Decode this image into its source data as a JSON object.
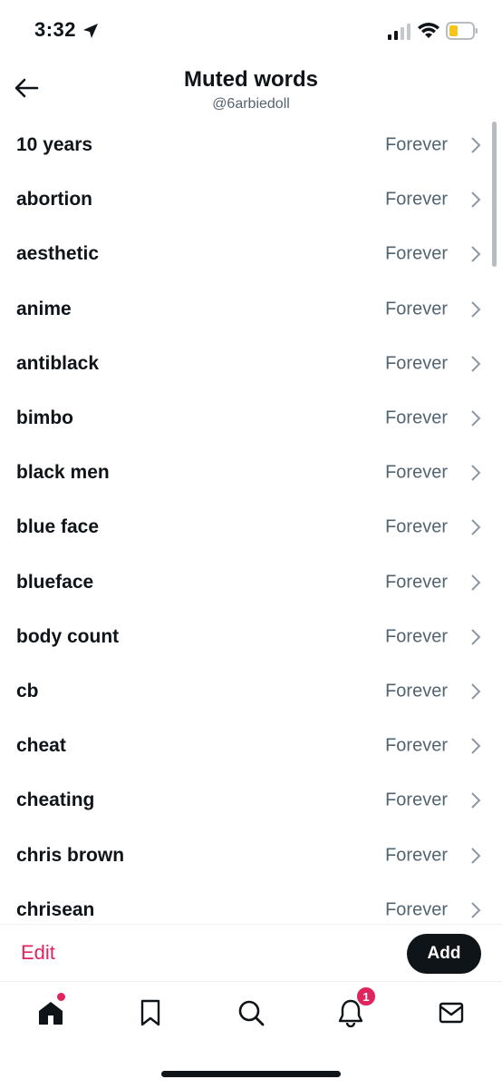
{
  "status_bar": {
    "time": "3:32"
  },
  "header": {
    "title": "Muted words",
    "subtitle": "@6arbiedoll"
  },
  "muted_words": [
    {
      "word": "10 years",
      "duration": "Forever"
    },
    {
      "word": "abortion",
      "duration": "Forever"
    },
    {
      "word": "aesthetic",
      "duration": "Forever"
    },
    {
      "word": "anime",
      "duration": "Forever"
    },
    {
      "word": "antiblack",
      "duration": "Forever"
    },
    {
      "word": "bimbo",
      "duration": "Forever"
    },
    {
      "word": "black men",
      "duration": "Forever"
    },
    {
      "word": "blue face",
      "duration": "Forever"
    },
    {
      "word": "blueface",
      "duration": "Forever"
    },
    {
      "word": "body count",
      "duration": "Forever"
    },
    {
      "word": "cb",
      "duration": "Forever"
    },
    {
      "word": "cheat",
      "duration": "Forever"
    },
    {
      "word": "cheating",
      "duration": "Forever"
    },
    {
      "word": "chris brown",
      "duration": "Forever"
    },
    {
      "word": "chrisean",
      "duration": "Forever"
    }
  ],
  "actions": {
    "edit_label": "Edit",
    "add_label": "Add"
  },
  "tab_bar": {
    "items": [
      {
        "icon": "home-icon",
        "active": true
      },
      {
        "icon": "bookmark-icon"
      },
      {
        "icon": "search-icon"
      },
      {
        "icon": "bell-icon",
        "badge": "1"
      },
      {
        "icon": "mail-icon"
      }
    ]
  },
  "colors": {
    "accent_pink": "#e0245e",
    "text_primary": "#0f1419",
    "text_secondary": "#536471",
    "battery_fill": "#f5c518"
  }
}
